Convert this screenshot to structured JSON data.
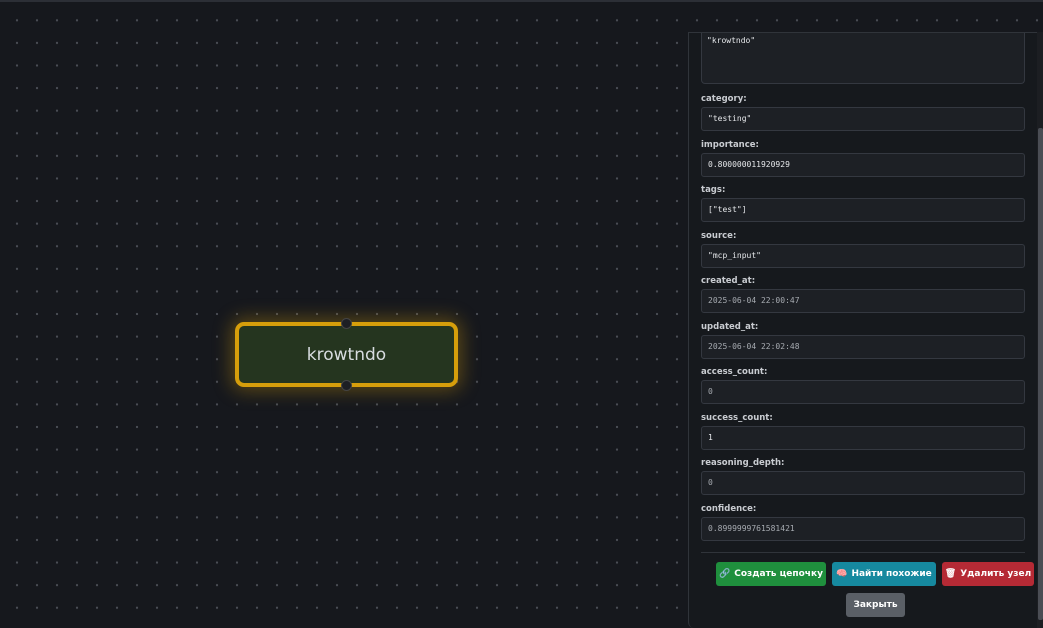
{
  "graph": {
    "node": {
      "label": "krowtndo",
      "border_color": "#d69e0b",
      "fill_color": "#25351f"
    }
  },
  "panel": {
    "content_value": "\"krowtndo\"",
    "fields": [
      {
        "label": "category:",
        "value": "\"testing\""
      },
      {
        "label": "importance:",
        "value": "0.800000011920929"
      },
      {
        "label": "tags:",
        "value": "[\"test\"]"
      },
      {
        "label": "source:",
        "value": "\"mcp_input\""
      },
      {
        "label": "created_at:",
        "value": "2025-06-04 22:00:47"
      },
      {
        "label": "updated_at:",
        "value": "2025-06-04 22:02:48"
      },
      {
        "label": "access_count:",
        "value": "0"
      },
      {
        "label": "success_count:",
        "value": "1"
      },
      {
        "label": "reasoning_depth:",
        "value": "0"
      },
      {
        "label": "confidence:",
        "value": "0.8999999761581421"
      }
    ],
    "buttons": {
      "create_chain": {
        "label": "Создать цепочку",
        "icon": "link-icon",
        "color": "#1f8f3d"
      },
      "find_similar": {
        "label": "Найти похожие",
        "icon": "brain-icon",
        "color": "#16899f"
      },
      "delete_node": {
        "label": "Удалить узел",
        "icon": "trash-icon",
        "color": "#b52a35"
      },
      "close": {
        "label": "Закрыть",
        "color": "#5a5f66"
      }
    }
  }
}
